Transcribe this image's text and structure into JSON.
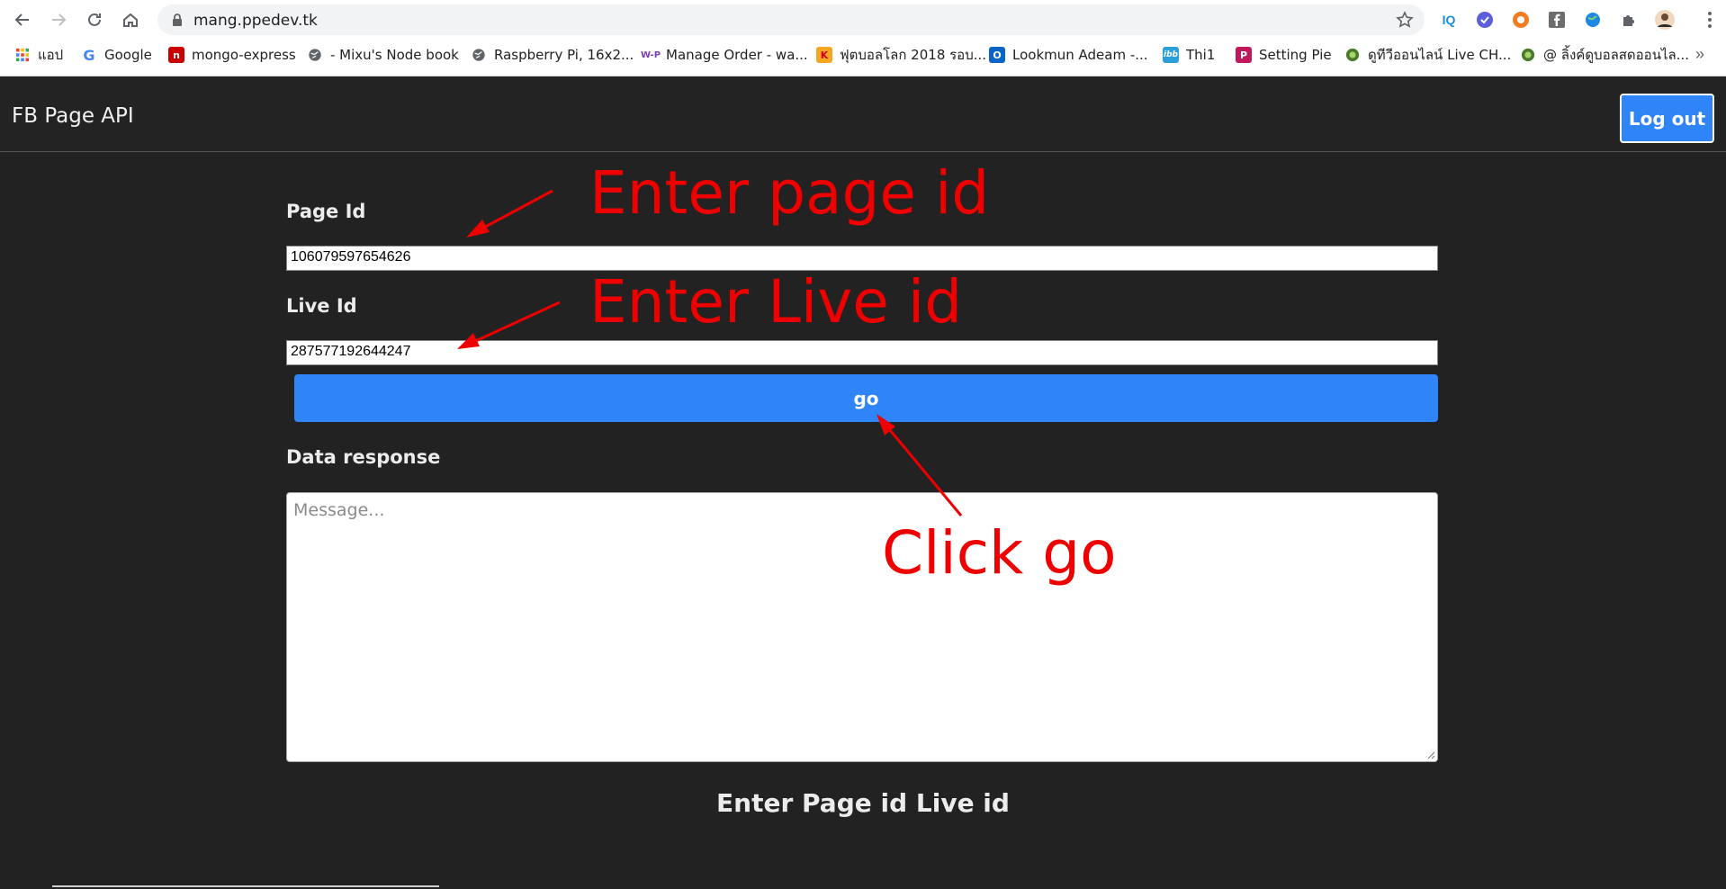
{
  "browser": {
    "url": "mang.ppedev.tk",
    "bookmarks": [
      {
        "label": "แอป",
        "icon": "apps-grid-icon"
      },
      {
        "label": "Google",
        "icon": "google-icon"
      },
      {
        "label": "mongo-express",
        "icon": "npm-icon"
      },
      {
        "label": "- Mixu's Node book",
        "icon": "globe-icon"
      },
      {
        "label": "Raspberry Pi, 16x2...",
        "icon": "globe-icon"
      },
      {
        "label": "Manage Order - wa...",
        "icon": "wp-icon"
      },
      {
        "label": "ฟุตบอลโลก 2018 รอบ...",
        "icon": "k-icon"
      },
      {
        "label": "Lookmun Adeam -...",
        "icon": "outlook-icon"
      },
      {
        "label": "Thi1",
        "icon": "ibb-icon"
      },
      {
        "label": "Setting Pie",
        "icon": "pie-icon"
      },
      {
        "label": "ดูทีวีออนไลน์ Live CH...",
        "icon": "tv-icon"
      },
      {
        "label": "@ ลิ้งค์ดูบอลสดออนไล...",
        "icon": "tv-icon"
      }
    ],
    "more_label": "»"
  },
  "navbar": {
    "brand": "FB Page API",
    "logout_label": "Log out"
  },
  "form": {
    "page_id_label": "Page Id",
    "page_id_value": "106079597654626",
    "live_id_label": "Live Id",
    "live_id_value": "287577192644247",
    "go_label": "go",
    "response_label": "Data response",
    "response_placeholder": "Message...",
    "footer_text": "Enter Page id Live id"
  },
  "annotations": {
    "page_id_note": "Enter page id",
    "live_id_note": "Enter Live id",
    "go_note": "Click go"
  },
  "colors": {
    "accent": "#2f84f7",
    "background": "#222222",
    "annotation": "#ee0000"
  }
}
